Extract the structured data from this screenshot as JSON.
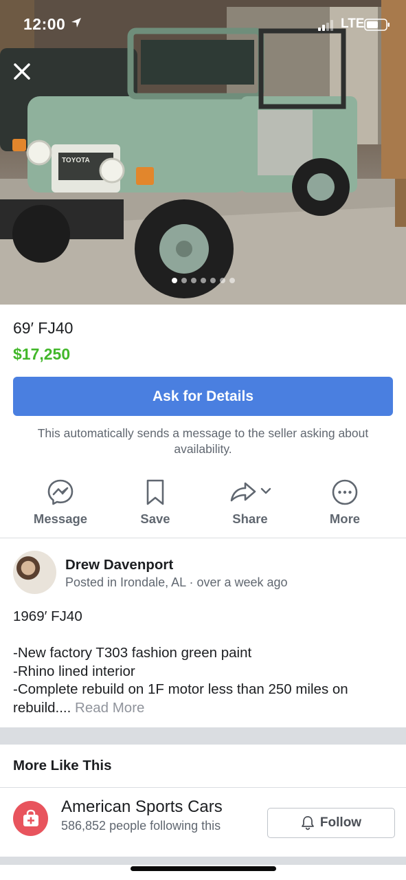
{
  "status_bar": {
    "time": "12:00",
    "network": "LTE"
  },
  "hero": {
    "photo_count": 7,
    "active_index": 0,
    "badge_text": "TOYOTA"
  },
  "listing": {
    "title": "69′ FJ40",
    "price": "$17,250",
    "price_color": "#42b72a",
    "ask_button": "Ask for Details",
    "ask_button_color": "#4a7fe0",
    "ask_note": "This automatically sends a message to the seller asking about availability."
  },
  "actions": [
    {
      "label": "Message",
      "icon": "messenger-icon"
    },
    {
      "label": "Save",
      "icon": "bookmark-icon"
    },
    {
      "label": "Share",
      "icon": "share-icon"
    },
    {
      "label": "More",
      "icon": "more-icon"
    }
  ],
  "seller": {
    "name": "Drew Davenport",
    "meta": "Posted in Irondale, AL · over a week ago"
  },
  "description": {
    "line1": "1969′ FJ40",
    "line2": "-New factory T303 fashion green paint",
    "line3": "-Rhino lined interior",
    "line4": "-Complete rebuild on 1F motor less than 250 miles on",
    "line5": "rebuild....",
    "read_more": "Read More"
  },
  "more_like_this": {
    "title": "More Like This",
    "page_name": "American Sports Cars",
    "followers": "586,852 people following this",
    "follow_button": "Follow",
    "page_icon_color": "#e8545d"
  }
}
